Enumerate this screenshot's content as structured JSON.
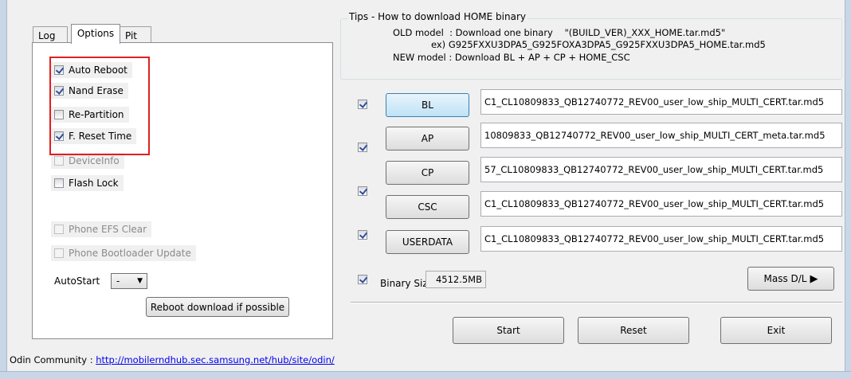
{
  "tabs": [
    {
      "label": "Log"
    },
    {
      "label": "Options"
    },
    {
      "label": "Pit"
    }
  ],
  "options": {
    "auto_reboot": {
      "label": "Auto Reboot",
      "checked": true
    },
    "nand_erase": {
      "label": "Nand Erase",
      "checked": true
    },
    "re_partition": {
      "label": "Re-Partition",
      "checked": false
    },
    "f_reset_time": {
      "label": "F. Reset Time",
      "checked": true
    },
    "device_info": {
      "label": "DeviceInfo",
      "checked": false,
      "disabled": true
    },
    "flash_lock": {
      "label": "Flash Lock",
      "checked": false
    },
    "phone_efs_clear": {
      "label": "Phone EFS Clear",
      "checked": false,
      "disabled": true
    },
    "phone_bootloader_update": {
      "label": "Phone Bootloader Update",
      "checked": false,
      "disabled": true
    },
    "autostart_label": "AutoStart",
    "autostart_value": "-",
    "reboot_download_label": "Reboot download if possible"
  },
  "tips": {
    "title": "Tips - How to download HOME binary",
    "line1": "OLD model  : Download one binary    \"(BUILD_VER)_XXX_HOME.tar.md5\"",
    "line2": "ex) G925FXXU3DPA5_G925FOXA3DPA5_G925FXXU3DPA5_HOME.tar.md5",
    "line3": "NEW model : Download BL + AP + CP + HOME_CSC"
  },
  "files": [
    {
      "label": "BL",
      "checked": true,
      "path": "C1_CL10809833_QB12740772_REV00_user_low_ship_MULTI_CERT.tar.md5"
    },
    {
      "label": "AP",
      "checked": true,
      "path": "10809833_QB12740772_REV00_user_low_ship_MULTI_CERT_meta.tar.md5"
    },
    {
      "label": "CP",
      "checked": true,
      "path": "57_CL10809833_QB12740772_REV00_user_low_ship_MULTI_CERT.tar.md5"
    },
    {
      "label": "CSC",
      "checked": true,
      "path": "C1_CL10809833_QB12740772_REV00_user_low_ship_MULTI_CERT.tar.md5"
    },
    {
      "label": "USERDATA",
      "checked": true,
      "path": "C1_CL10809833_QB12740772_REV00_user_low_ship_MULTI_CERT.tar.md5"
    }
  ],
  "binary": {
    "label": "Binary Size",
    "value": "4512.5MB"
  },
  "mass_dl_label": "Mass D/L",
  "actions": {
    "start": "Start",
    "reset": "Reset",
    "exit": "Exit"
  },
  "community": {
    "label": "Odin Community : ",
    "url": "http://mobilerndhub.sec.samsung.net/hub/site/odin/"
  },
  "colors": {
    "highlight_box": "#e02020",
    "link": "#0000ee"
  }
}
